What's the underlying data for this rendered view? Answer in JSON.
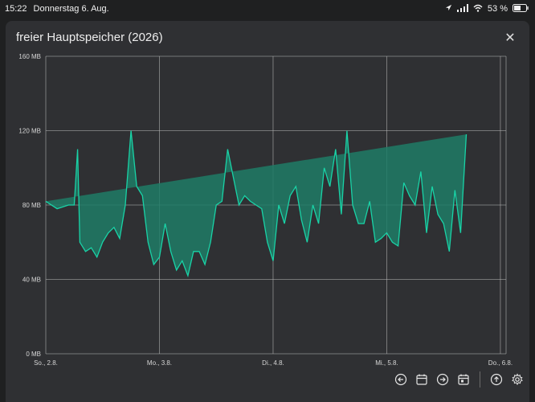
{
  "status": {
    "time": "15:22",
    "date": "Donnerstag 6. Aug.",
    "battery": "53 %"
  },
  "dialog": {
    "title": "freier Hauptspeicher (2026)"
  },
  "toolbar": {
    "buttons": [
      "arrow-left-icon",
      "calendar-icon",
      "arrow-right-icon",
      "calendar-today-icon",
      "upload-icon",
      "gear-icon"
    ]
  },
  "colors": {
    "line": "#19d3a7",
    "fill": "#1f7b66",
    "grid": "#b7b7b7"
  },
  "chart_data": {
    "type": "area",
    "title": "",
    "xlabel": "",
    "ylabel": "",
    "y_ticks": [
      "0 MB",
      "40 MB",
      "80 MB",
      "120 MB",
      "160 MB"
    ],
    "ylim": [
      0,
      160
    ],
    "x_ticks": [
      "So., 2.8.",
      "Mo., 3.8.",
      "Di., 4.8.",
      "Mi., 5.8.",
      "Do., 6.8."
    ],
    "x_tick_pos": [
      0,
      1,
      2,
      3,
      4
    ],
    "xlim": [
      0,
      4.05
    ],
    "x": [
      0.0,
      0.1,
      0.2,
      0.25,
      0.28,
      0.3,
      0.35,
      0.4,
      0.45,
      0.5,
      0.55,
      0.6,
      0.65,
      0.7,
      0.75,
      0.8,
      0.85,
      0.9,
      0.95,
      1.0,
      1.05,
      1.1,
      1.15,
      1.2,
      1.25,
      1.3,
      1.35,
      1.4,
      1.45,
      1.5,
      1.55,
      1.6,
      1.65,
      1.7,
      1.75,
      1.8,
      1.85,
      1.9,
      1.95,
      2.0,
      2.05,
      2.1,
      2.15,
      2.2,
      2.25,
      2.3,
      2.35,
      2.4,
      2.45,
      2.5,
      2.55,
      2.6,
      2.65,
      2.7,
      2.75,
      2.8,
      2.85,
      2.9,
      2.95,
      3.0,
      3.05,
      3.1,
      3.15,
      3.2,
      3.25,
      3.3,
      3.35,
      3.4,
      3.45,
      3.5,
      3.55,
      3.6,
      3.65,
      3.7,
      3.75,
      3.8,
      3.85,
      3.9,
      3.95,
      4.0,
      4.02,
      4.05
    ],
    "y": [
      82,
      78,
      80,
      80,
      110,
      60,
      55,
      57,
      52,
      60,
      65,
      68,
      62,
      80,
      120,
      90,
      85,
      60,
      48,
      52,
      70,
      55,
      45,
      50,
      42,
      55,
      55,
      48,
      60,
      80,
      82,
      110,
      95,
      80,
      85,
      82,
      80,
      78,
      60,
      50,
      80,
      70,
      85,
      90,
      72,
      60,
      80,
      70,
      100,
      90,
      110,
      75,
      120,
      80,
      70,
      70,
      82,
      60,
      62,
      65,
      60,
      58,
      92,
      85,
      80,
      98,
      65,
      90,
      75,
      70,
      55,
      88,
      65,
      118
    ]
  }
}
